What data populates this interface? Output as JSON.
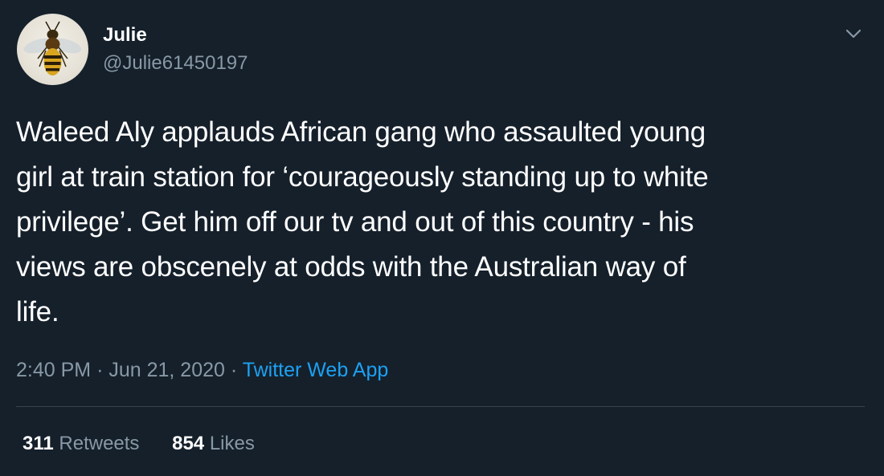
{
  "author": {
    "display_name": "Julie",
    "handle": "@Julie61450197",
    "avatar_icon": "wasp-avatar-icon"
  },
  "menu": {
    "icon": "chevron-down-icon"
  },
  "tweet": {
    "lines": [
      "Waleed Aly applauds African gang who assaulted young",
      "girl at train station for ‘courageously standing up to white",
      "privilege’. Get him off our tv and out of this country - his",
      "views are obscenely at odds with the Australian way of",
      "life."
    ]
  },
  "meta": {
    "time": "2:40 PM",
    "separator": "·",
    "date": "Jun 21, 2020",
    "source": "Twitter Web App"
  },
  "stats": {
    "retweets_count": "311",
    "retweets_label": "Retweets",
    "likes_count": "854",
    "likes_label": "Likes"
  },
  "colors": {
    "background": "#15202b",
    "text_primary": "#ffffff",
    "text_secondary": "#8899a6",
    "link": "#1da1f2",
    "divider": "#38444d"
  }
}
